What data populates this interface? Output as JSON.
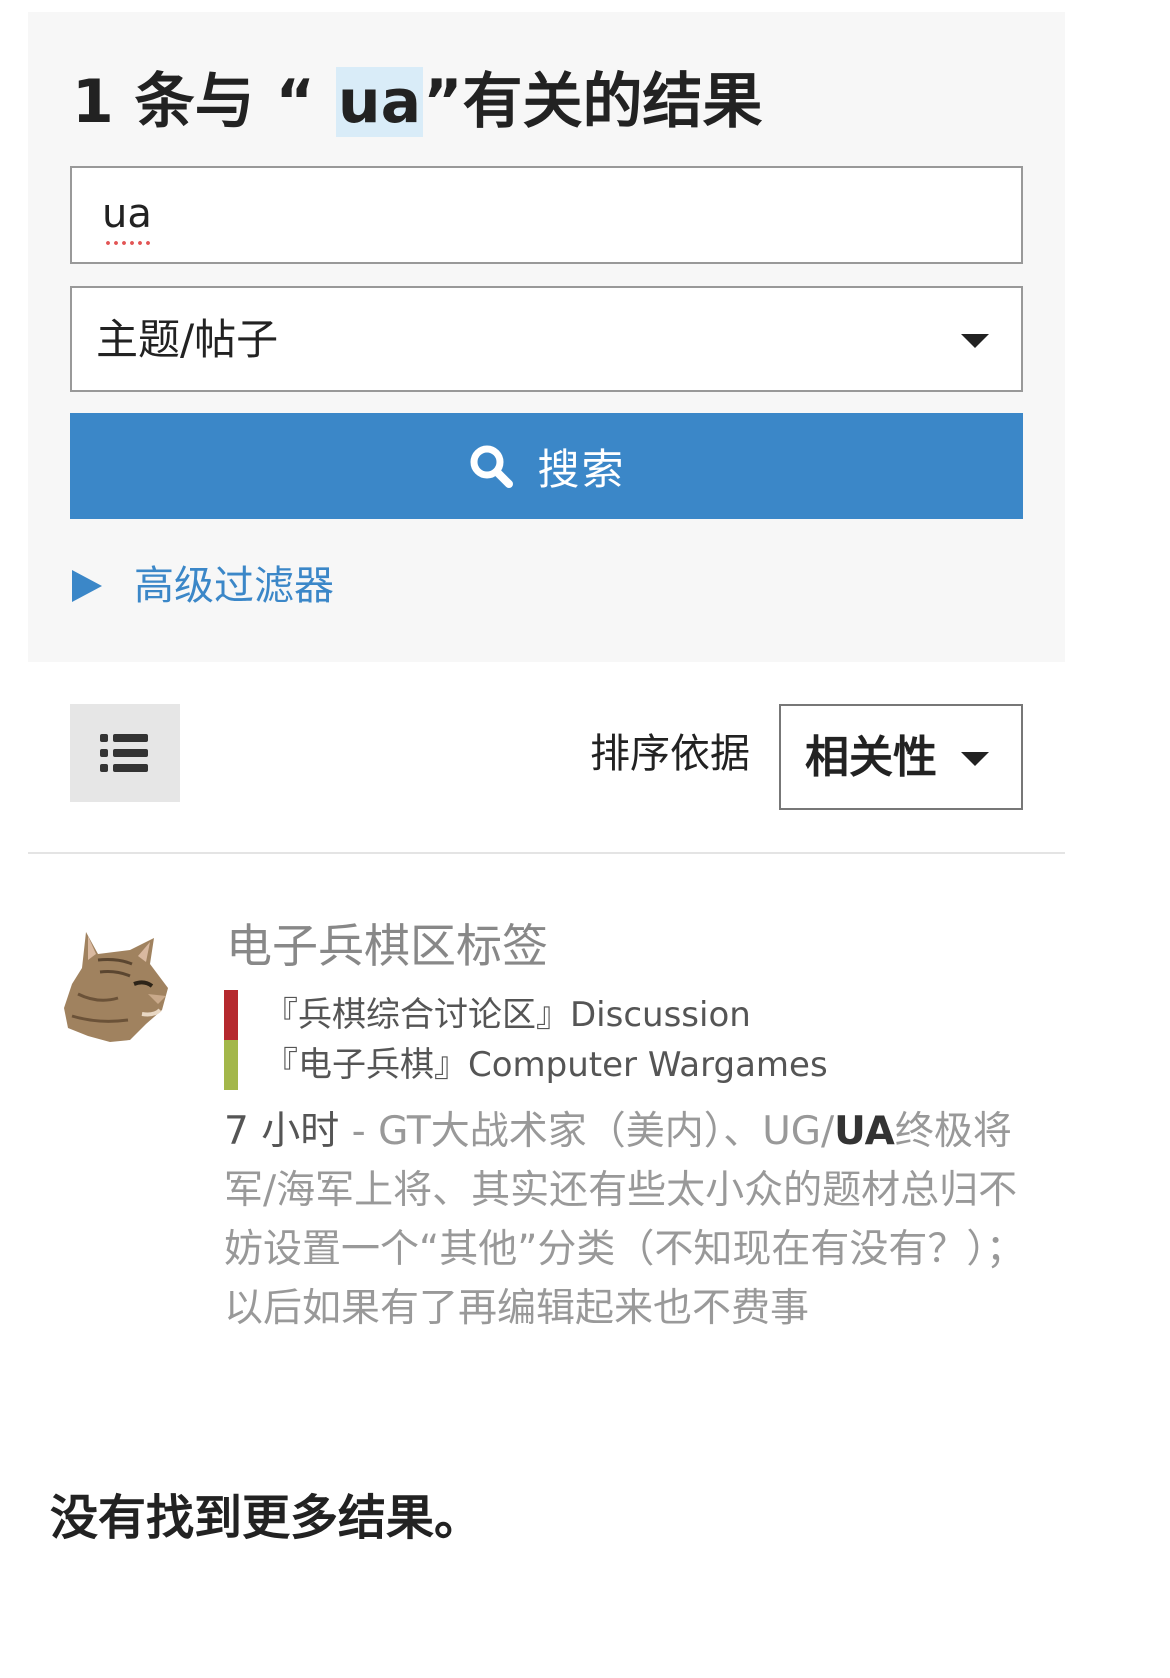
{
  "search": {
    "heading_prefix": "1 条与 “ ",
    "heading_query": "ua",
    "heading_suffix": "”有关的结果",
    "query": "ua",
    "type_selected": "主题/帖子",
    "button_label": "搜索",
    "advanced_filter_label": "高级过滤器"
  },
  "toolbar": {
    "sort_label": "排序依据",
    "sort_selected": "相关性"
  },
  "results": [
    {
      "title": "电子兵棋区标签",
      "tags": [
        {
          "label": "『兵棋综合讨论区』Discussion",
          "color": "#b5292e"
        },
        {
          "label": "『电子兵棋』Computer Wargames",
          "color": "#a3b74a"
        }
      ],
      "time": "7 小时",
      "snippet_before": " - GT大战术家（美内）、UG/",
      "snippet_highlight": "UA",
      "snippet_after": "终极将军/海军上将、其实还有些太小众的题材总归不妨设置一个“其他”分类（不知现在有没有？）；以后如果有了再编辑起来也不费事"
    }
  ],
  "footer": {
    "no_more_results": "没有找到更多结果。"
  },
  "colors": {
    "accent": "#3b87c8",
    "panel_bg": "#f7f7f7"
  }
}
